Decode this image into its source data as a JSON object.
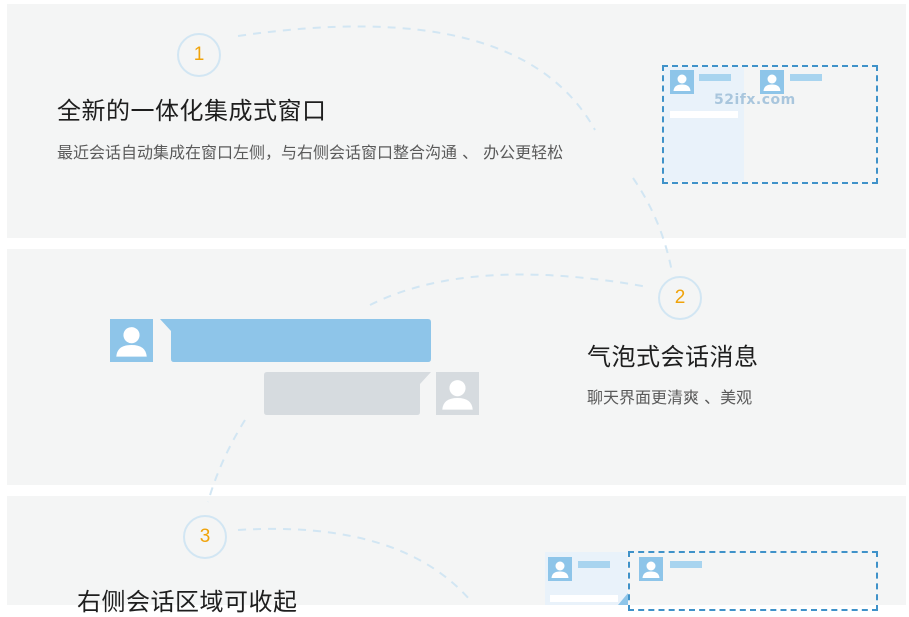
{
  "features": [
    {
      "number": "1",
      "title": "全新的一体化集成式窗口",
      "description": "最近会话自动集成在窗口左侧，与右侧会话窗口整合沟通 、 办公更轻松"
    },
    {
      "number": "2",
      "title": "气泡式会话消息",
      "description": "聊天界面更清爽 、美观"
    },
    {
      "number": "3",
      "title": "右侧会话区域可收起",
      "description": ""
    }
  ],
  "watermark": "52ifx.com",
  "icons": {
    "avatar": "user-avatar-icon"
  },
  "colors": {
    "accent": "#f0a30a",
    "frame": "#3f92c9",
    "bubble_blue": "#8ec5e9",
    "bubble_gray": "#d6dbdf",
    "panel": "#f4f5f5"
  }
}
